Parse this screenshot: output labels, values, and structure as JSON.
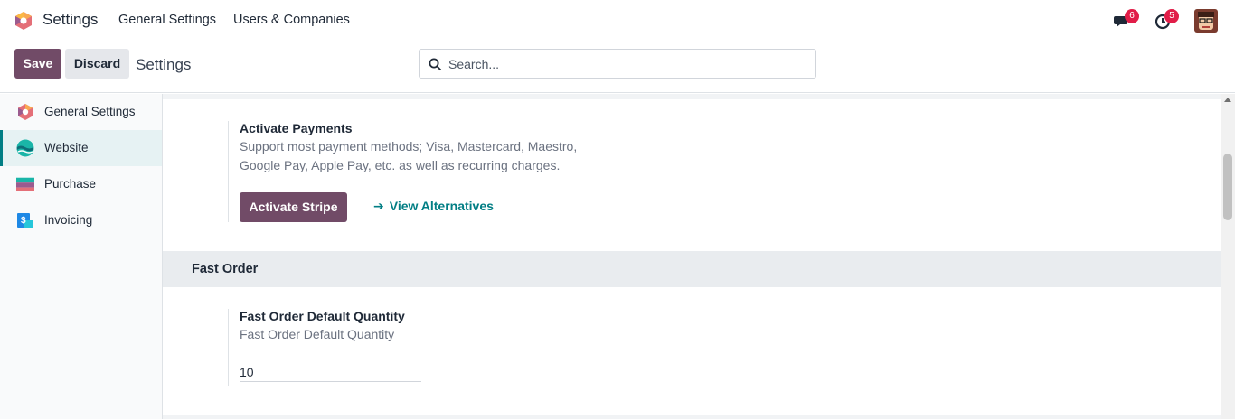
{
  "navbar": {
    "app_name": "Settings",
    "menu": [
      "General Settings",
      "Users & Companies"
    ],
    "messages_badge": "6",
    "activities_badge": "5"
  },
  "control": {
    "save_label": "Save",
    "discard_label": "Discard",
    "title": "Settings",
    "search_placeholder": "Search..."
  },
  "sidebar": {
    "items": [
      {
        "label": "General Settings",
        "icon": "odoo-logo-icon"
      },
      {
        "label": "Website",
        "icon": "website-icon",
        "active": true
      },
      {
        "label": "Purchase",
        "icon": "purchase-icon"
      },
      {
        "label": "Invoicing",
        "icon": "invoicing-icon"
      }
    ]
  },
  "payments": {
    "title": "Activate Payments",
    "desc_line1": "Support most payment methods; Visa, Mastercard, Maestro,",
    "desc_line2": "Google Pay, Apple Pay, etc. as well as recurring charges.",
    "stripe_button": "Activate Stripe",
    "alternatives_link": "View Alternatives"
  },
  "fast_order": {
    "section_title": "Fast Order",
    "setting_title": "Fast Order Default Quantity",
    "setting_desc": "Fast Order Default Quantity",
    "quantity_value": "10"
  },
  "colors": {
    "primary": "#714b67",
    "link": "#017e84",
    "badge": "#e11d48"
  }
}
